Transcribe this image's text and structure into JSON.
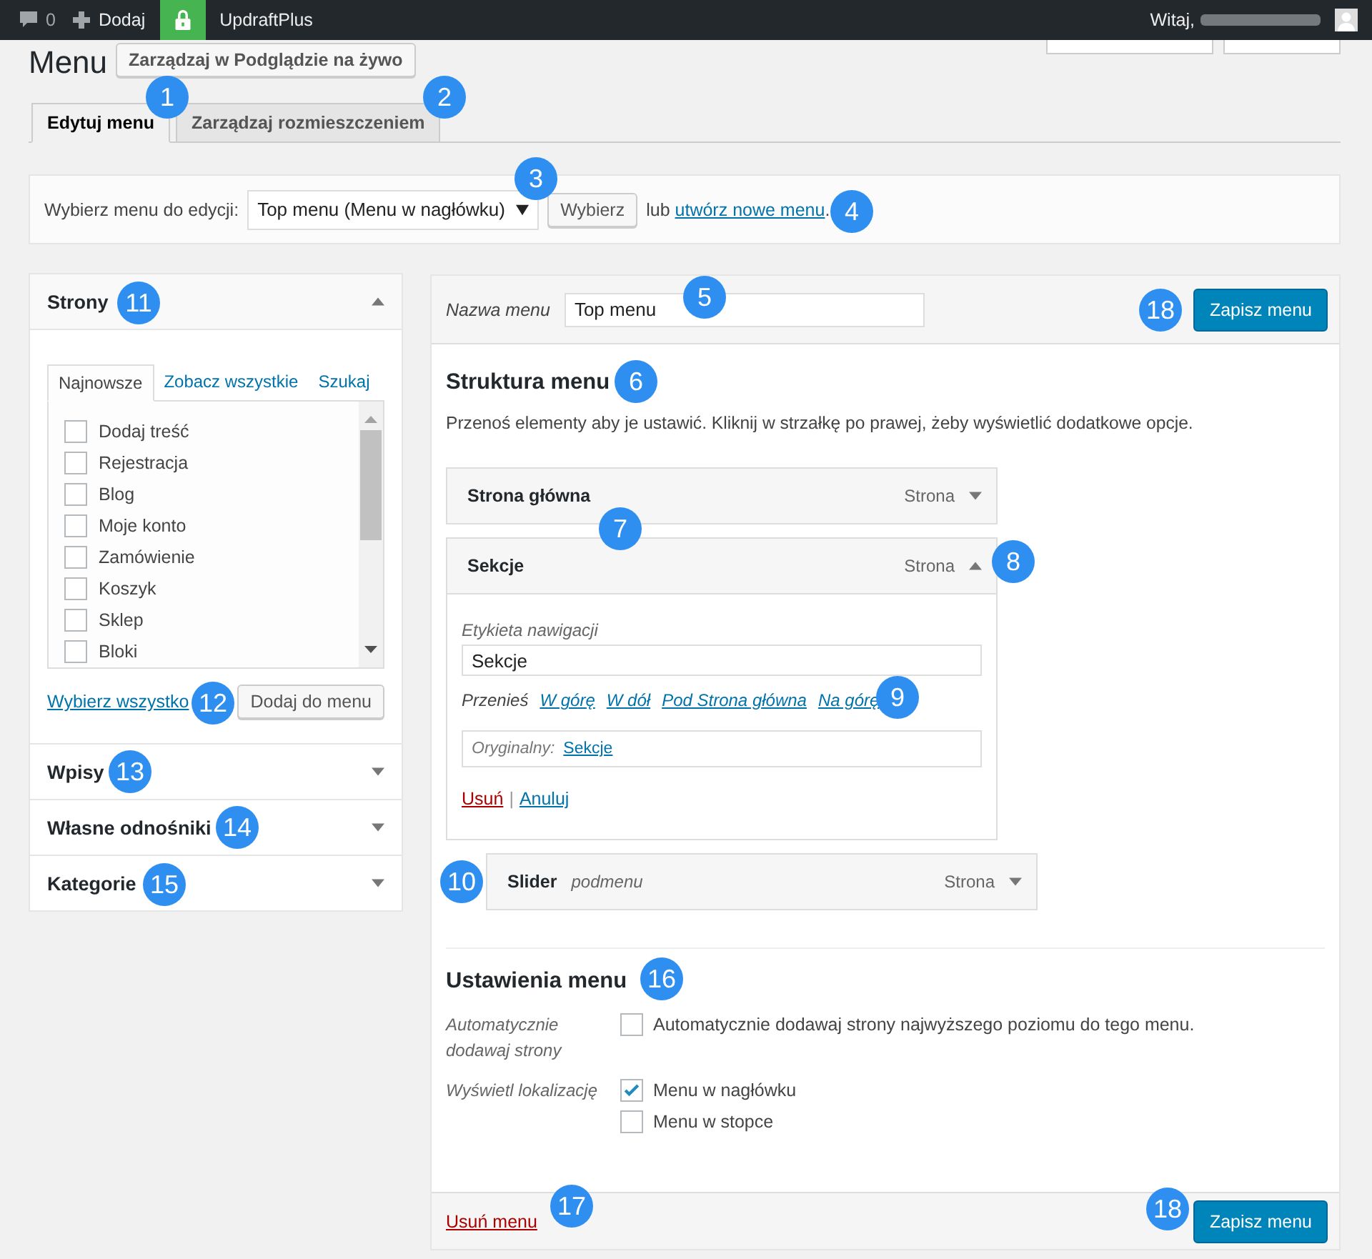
{
  "admin_bar": {
    "comments": "0",
    "new": "Dodaj",
    "plugin": "UpdraftPlus",
    "greeting": "Witaj,"
  },
  "page_title": "Menu",
  "live_button": "Zarządzaj w Podglądzie na żywo",
  "tabs": [
    {
      "label": "Edytuj menu",
      "selected": true
    },
    {
      "label": "Zarządzaj rozmieszczeniem",
      "selected": false
    }
  ],
  "select_bar": {
    "label": "Wybierz menu do edycji:",
    "value": "Top menu (Menu w nagłówku)",
    "button": "Wybierz",
    "or": "lub",
    "link": "utwórz nowe menu",
    "after": "."
  },
  "sidebar": {
    "panels": [
      {
        "title": "Strony",
        "expanded": true
      },
      {
        "title": "Wpisy",
        "expanded": false
      },
      {
        "title": "Własne odnośniki",
        "expanded": false
      },
      {
        "title": "Kategorie",
        "expanded": false
      }
    ],
    "tabs": [
      {
        "label": "Najnowsze",
        "selected": true
      },
      {
        "label": "Zobacz wszystkie",
        "selected": false
      },
      {
        "label": "Szukaj",
        "selected": false
      }
    ],
    "pages": [
      {
        "label": "Dodaj treść",
        "checked": false
      },
      {
        "label": "Rejestracja",
        "checked": false
      },
      {
        "label": "Blog",
        "checked": false
      },
      {
        "label": "Moje konto",
        "checked": false
      },
      {
        "label": "Zamówienie",
        "checked": false
      },
      {
        "label": "Koszyk",
        "checked": false
      },
      {
        "label": "Sklep",
        "checked": false
      },
      {
        "label": "Bloki",
        "checked": false
      }
    ],
    "select_all": "Wybierz wszystko",
    "add_button": "Dodaj do menu"
  },
  "editor": {
    "name_label": "Nazwa menu",
    "name_value": "Top menu",
    "save_button": "Zapisz menu",
    "heading": "Struktura menu",
    "help": "Przenoś elementy aby je ustawić. Kliknij w strzałkę po prawej, żeby wyświetlić dodatkowe opcje.",
    "items": [
      {
        "title": "Strona główna",
        "type": "Strona",
        "expanded": false
      },
      {
        "title": "Sekcje",
        "type": "Strona",
        "expanded": true,
        "children": [
          {
            "title": "Slider",
            "subtitle": "podmenu",
            "type": "Strona",
            "expanded": false
          }
        ]
      }
    ],
    "details": {
      "nav_label": "Etykieta nawigacji",
      "nav_value": "Sekcje",
      "move_label": "Przenieś",
      "move_links": [
        "W górę",
        "W dół",
        "Pod Strona główna",
        "Na górę"
      ],
      "original_label": "Oryginalny:",
      "original_link": "Sekcje",
      "remove": "Usuń",
      "separator": "|",
      "cancel": "Anuluj"
    },
    "settings_heading": "Ustawienia menu",
    "settings": [
      {
        "label": "Automatycznie dodawaj strony",
        "options": [
          {
            "label": "Automatycznie dodawaj strony najwyższego poziomu do tego menu.",
            "checked": false
          }
        ]
      },
      {
        "label": "Wyświetl lokalizację",
        "options": [
          {
            "label": "Menu w nagłówku",
            "checked": true
          },
          {
            "label": "Menu w stopce",
            "checked": false
          }
        ]
      }
    ],
    "delete_link": "Usuń menu",
    "footer_save_button": "Zapisz menu"
  },
  "callouts": [
    "1",
    "2",
    "3",
    "4",
    "5",
    "6",
    "7",
    "8",
    "9",
    "10",
    "11",
    "12",
    "13",
    "14",
    "15",
    "16",
    "17",
    "18",
    "18"
  ]
}
